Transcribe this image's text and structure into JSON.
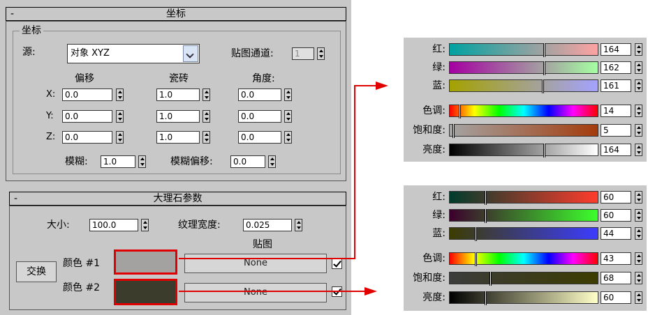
{
  "coords": {
    "title": "坐标",
    "group_title": "坐标",
    "source_label": "源:",
    "source_value": "对象 XYZ",
    "map_channel_label": "贴图通道:",
    "map_channel_value": "1",
    "col_offset": "偏移",
    "col_tiling": "瓷砖",
    "col_angle": "角度:",
    "rows": [
      {
        "axis": "X:",
        "offset": "0.0",
        "tiling": "1.0",
        "angle": "0.0"
      },
      {
        "axis": "Y:",
        "offset": "0.0",
        "tiling": "1.0",
        "angle": "0.0"
      },
      {
        "axis": "Z:",
        "offset": "0.0",
        "tiling": "1.0",
        "angle": "0.0"
      }
    ],
    "blur_label": "模糊:",
    "blur_value": "1.0",
    "blur_offset_label": "模糊偏移:",
    "blur_offset_value": "0.0"
  },
  "marble": {
    "title": "大理石参数",
    "size_label": "大小:",
    "size_value": "100.0",
    "vein_width_label": "纹理宽度:",
    "vein_width_value": "0.025",
    "maps_label": "贴图",
    "swap_label": "交换",
    "color1_label": "颜色 #1",
    "color2_label": "颜色 #2",
    "color1_swatch": "#a4a2a1",
    "color2_swatch": "#3c3c2c",
    "map1_label": "None",
    "map2_label": "None"
  },
  "picker1": {
    "rows": [
      {
        "label": "红:",
        "value": "164",
        "marker": 0.64,
        "grad": "linear-gradient(to right,#00a2a1,#ffa2a1)"
      },
      {
        "label": "绿:",
        "value": "162",
        "marker": 0.64,
        "grad": "linear-gradient(to right,#a400a1,#a4ffa1)"
      },
      {
        "label": "蓝:",
        "value": "161",
        "marker": 0.63,
        "grad": "linear-gradient(to right,#a4a200,#a4a2ff)"
      },
      {
        "label": "色调:",
        "value": "14",
        "marker": 0.06,
        "grad": "linear-gradient(to right,#f00,#ff0,#0f0,#0ff,#00f,#f0f,#f00)"
      },
      {
        "label": "饱和度:",
        "value": "5",
        "marker": 0.02,
        "grad": "linear-gradient(to right,#a4a4a4,#a43c0c)"
      },
      {
        "label": "亮度:",
        "value": "164",
        "marker": 0.64,
        "grad": "linear-gradient(to right,#000,#ffffff)"
      }
    ]
  },
  "picker2": {
    "rows": [
      {
        "label": "红:",
        "value": "60",
        "marker": 0.24,
        "grad": "linear-gradient(to right,#003c2c,#ff3c2c)"
      },
      {
        "label": "绿:",
        "value": "60",
        "marker": 0.24,
        "grad": "linear-gradient(to right,#3c002c,#3cff2c)"
      },
      {
        "label": "蓝:",
        "value": "44",
        "marker": 0.17,
        "grad": "linear-gradient(to right,#3c3c00,#3c3cff)"
      },
      {
        "label": "色调:",
        "value": "43",
        "marker": 0.17,
        "grad": "linear-gradient(to right,#f00,#ff0,#0f0,#0ff,#00f,#f0f,#f00)"
      },
      {
        "label": "饱和度:",
        "value": "68",
        "marker": 0.27,
        "grad": "linear-gradient(to right,#3c3c3c,#3c3c00)"
      },
      {
        "label": "亮度:",
        "value": "60",
        "marker": 0.24,
        "grad": "linear-gradient(to right,#000,#ffffc8)"
      }
    ]
  },
  "colors": {
    "accent_red": "#e00000",
    "panel_bg": "#c8c8c8"
  }
}
